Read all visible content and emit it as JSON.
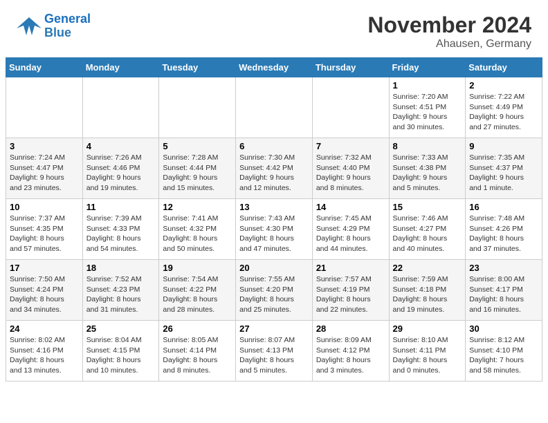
{
  "header": {
    "logo_line1": "General",
    "logo_line2": "Blue",
    "month": "November 2024",
    "location": "Ahausen, Germany"
  },
  "weekdays": [
    "Sunday",
    "Monday",
    "Tuesday",
    "Wednesday",
    "Thursday",
    "Friday",
    "Saturday"
  ],
  "weeks": [
    [
      {
        "day": "",
        "info": ""
      },
      {
        "day": "",
        "info": ""
      },
      {
        "day": "",
        "info": ""
      },
      {
        "day": "",
        "info": ""
      },
      {
        "day": "",
        "info": ""
      },
      {
        "day": "1",
        "info": "Sunrise: 7:20 AM\nSunset: 4:51 PM\nDaylight: 9 hours\nand 30 minutes."
      },
      {
        "day": "2",
        "info": "Sunrise: 7:22 AM\nSunset: 4:49 PM\nDaylight: 9 hours\nand 27 minutes."
      }
    ],
    [
      {
        "day": "3",
        "info": "Sunrise: 7:24 AM\nSunset: 4:47 PM\nDaylight: 9 hours\nand 23 minutes."
      },
      {
        "day": "4",
        "info": "Sunrise: 7:26 AM\nSunset: 4:46 PM\nDaylight: 9 hours\nand 19 minutes."
      },
      {
        "day": "5",
        "info": "Sunrise: 7:28 AM\nSunset: 4:44 PM\nDaylight: 9 hours\nand 15 minutes."
      },
      {
        "day": "6",
        "info": "Sunrise: 7:30 AM\nSunset: 4:42 PM\nDaylight: 9 hours\nand 12 minutes."
      },
      {
        "day": "7",
        "info": "Sunrise: 7:32 AM\nSunset: 4:40 PM\nDaylight: 9 hours\nand 8 minutes."
      },
      {
        "day": "8",
        "info": "Sunrise: 7:33 AM\nSunset: 4:38 PM\nDaylight: 9 hours\nand 5 minutes."
      },
      {
        "day": "9",
        "info": "Sunrise: 7:35 AM\nSunset: 4:37 PM\nDaylight: 9 hours\nand 1 minute."
      }
    ],
    [
      {
        "day": "10",
        "info": "Sunrise: 7:37 AM\nSunset: 4:35 PM\nDaylight: 8 hours\nand 57 minutes."
      },
      {
        "day": "11",
        "info": "Sunrise: 7:39 AM\nSunset: 4:33 PM\nDaylight: 8 hours\nand 54 minutes."
      },
      {
        "day": "12",
        "info": "Sunrise: 7:41 AM\nSunset: 4:32 PM\nDaylight: 8 hours\nand 50 minutes."
      },
      {
        "day": "13",
        "info": "Sunrise: 7:43 AM\nSunset: 4:30 PM\nDaylight: 8 hours\nand 47 minutes."
      },
      {
        "day": "14",
        "info": "Sunrise: 7:45 AM\nSunset: 4:29 PM\nDaylight: 8 hours\nand 44 minutes."
      },
      {
        "day": "15",
        "info": "Sunrise: 7:46 AM\nSunset: 4:27 PM\nDaylight: 8 hours\nand 40 minutes."
      },
      {
        "day": "16",
        "info": "Sunrise: 7:48 AM\nSunset: 4:26 PM\nDaylight: 8 hours\nand 37 minutes."
      }
    ],
    [
      {
        "day": "17",
        "info": "Sunrise: 7:50 AM\nSunset: 4:24 PM\nDaylight: 8 hours\nand 34 minutes."
      },
      {
        "day": "18",
        "info": "Sunrise: 7:52 AM\nSunset: 4:23 PM\nDaylight: 8 hours\nand 31 minutes."
      },
      {
        "day": "19",
        "info": "Sunrise: 7:54 AM\nSunset: 4:22 PM\nDaylight: 8 hours\nand 28 minutes."
      },
      {
        "day": "20",
        "info": "Sunrise: 7:55 AM\nSunset: 4:20 PM\nDaylight: 8 hours\nand 25 minutes."
      },
      {
        "day": "21",
        "info": "Sunrise: 7:57 AM\nSunset: 4:19 PM\nDaylight: 8 hours\nand 22 minutes."
      },
      {
        "day": "22",
        "info": "Sunrise: 7:59 AM\nSunset: 4:18 PM\nDaylight: 8 hours\nand 19 minutes."
      },
      {
        "day": "23",
        "info": "Sunrise: 8:00 AM\nSunset: 4:17 PM\nDaylight: 8 hours\nand 16 minutes."
      }
    ],
    [
      {
        "day": "24",
        "info": "Sunrise: 8:02 AM\nSunset: 4:16 PM\nDaylight: 8 hours\nand 13 minutes."
      },
      {
        "day": "25",
        "info": "Sunrise: 8:04 AM\nSunset: 4:15 PM\nDaylight: 8 hours\nand 10 minutes."
      },
      {
        "day": "26",
        "info": "Sunrise: 8:05 AM\nSunset: 4:14 PM\nDaylight: 8 hours\nand 8 minutes."
      },
      {
        "day": "27",
        "info": "Sunrise: 8:07 AM\nSunset: 4:13 PM\nDaylight: 8 hours\nand 5 minutes."
      },
      {
        "day": "28",
        "info": "Sunrise: 8:09 AM\nSunset: 4:12 PM\nDaylight: 8 hours\nand 3 minutes."
      },
      {
        "day": "29",
        "info": "Sunrise: 8:10 AM\nSunset: 4:11 PM\nDaylight: 8 hours\nand 0 minutes."
      },
      {
        "day": "30",
        "info": "Sunrise: 8:12 AM\nSunset: 4:10 PM\nDaylight: 7 hours\nand 58 minutes."
      }
    ]
  ]
}
